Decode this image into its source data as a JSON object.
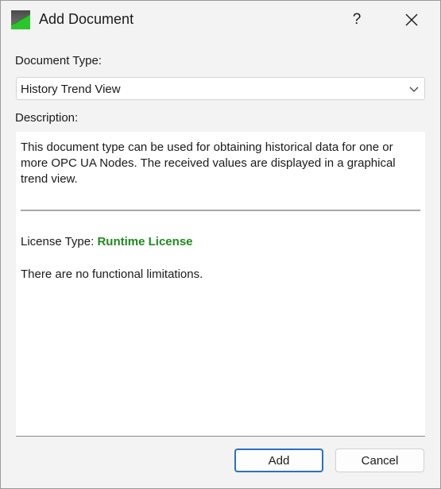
{
  "window": {
    "title": "Add Document",
    "help_label": "?",
    "icons": {
      "app": "trend-chart-icon",
      "close": "close-icon"
    }
  },
  "form": {
    "document_type_label": "Document Type:",
    "document_type_value": "History Trend View",
    "description_label": "Description:"
  },
  "description": {
    "text": "This document type can be used for obtaining historical data for one or more OPC UA Nodes. The received values are displayed in a graphical trend view.",
    "license_label": "License Type:",
    "license_value": "Runtime License",
    "limitations": "There are no functional limitations."
  },
  "buttons": {
    "add": "Add",
    "cancel": "Cancel"
  },
  "colors": {
    "license_value": "#1d8a1d",
    "primary_button_border": "#2a6fc9"
  }
}
